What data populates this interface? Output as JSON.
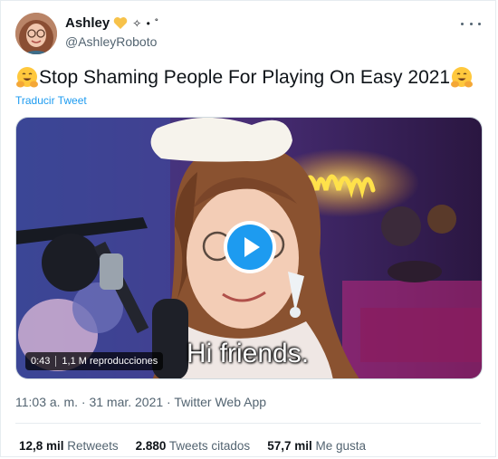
{
  "tweet": {
    "author_name": "Ashley",
    "name_decoration": "✧ • ˚",
    "handle": "@AshleyRoboto",
    "text": "Stop Shaming People For Playing On Easy 2021",
    "translate_label": "Traducir Tweet",
    "video": {
      "duration": "0:43",
      "views": "1,1 M reproducciones",
      "caption": "Hi friends."
    },
    "meta": "11:03 a. m. · 31 mar. 2021 · Twitter Web App",
    "stats": {
      "retweets_count": "12,8 mil",
      "retweets_label": "Retweets",
      "quotes_count": "2.880",
      "quotes_label": "Tweets citados",
      "likes_count": "57,7 mil",
      "likes_label": "Me gusta"
    }
  },
  "icons": {
    "heart": "yellow-heart-icon",
    "hug": "hugging-face-emoji",
    "more": "more-icon",
    "play": "play-icon"
  },
  "colors": {
    "accent": "#1d9bf0",
    "text": "#0f1419",
    "secondary": "#536471",
    "heart": "#f7c24a",
    "emoji": "#ffc83d"
  }
}
